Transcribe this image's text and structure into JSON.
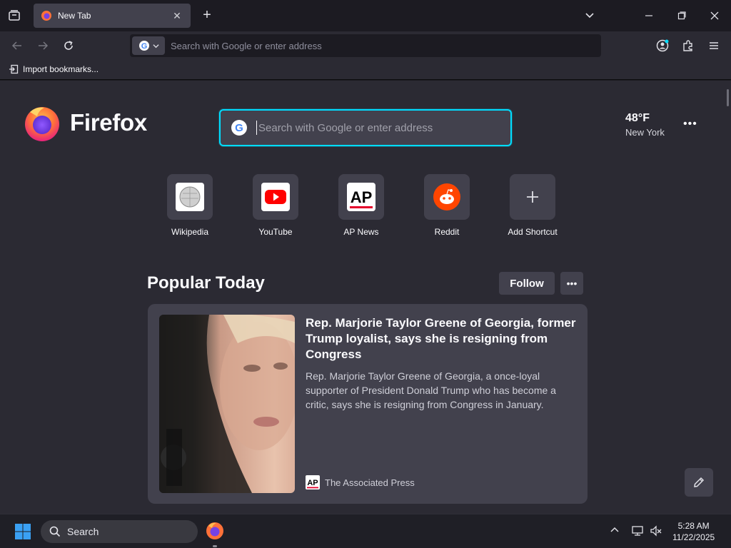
{
  "tab": {
    "title": "New Tab"
  },
  "navbar": {
    "url_placeholder": "Search with Google or enter address"
  },
  "bookmarks": {
    "import_label": "Import bookmarks..."
  },
  "brand": {
    "wordmark": "Firefox"
  },
  "hero_search": {
    "placeholder": "Search with Google or enter address"
  },
  "weather": {
    "temp": "48°F",
    "city": "New York"
  },
  "shortcuts": [
    {
      "label": "Wikipedia"
    },
    {
      "label": "YouTube"
    },
    {
      "label": "AP News"
    },
    {
      "label": "Reddit"
    },
    {
      "label": "Add Shortcut"
    }
  ],
  "popular": {
    "title": "Popular Today",
    "follow_label": "Follow",
    "card": {
      "headline": "Rep. Marjorie Taylor Greene of Georgia, former Trump loyalist, says she is resigning from Congress",
      "description": "Rep. Marjorie Taylor Greene of Georgia, a once-loyal supporter of President Donald Trump who has become a critic, says she is resigning from Congress in January.",
      "source": "The Associated Press"
    }
  },
  "taskbar": {
    "search_label": "Search",
    "time": "5:28 AM",
    "date": "11/22/2025"
  },
  "colors": {
    "accent": "#00ddff",
    "background": "#2b2a33",
    "card": "#42414d"
  }
}
